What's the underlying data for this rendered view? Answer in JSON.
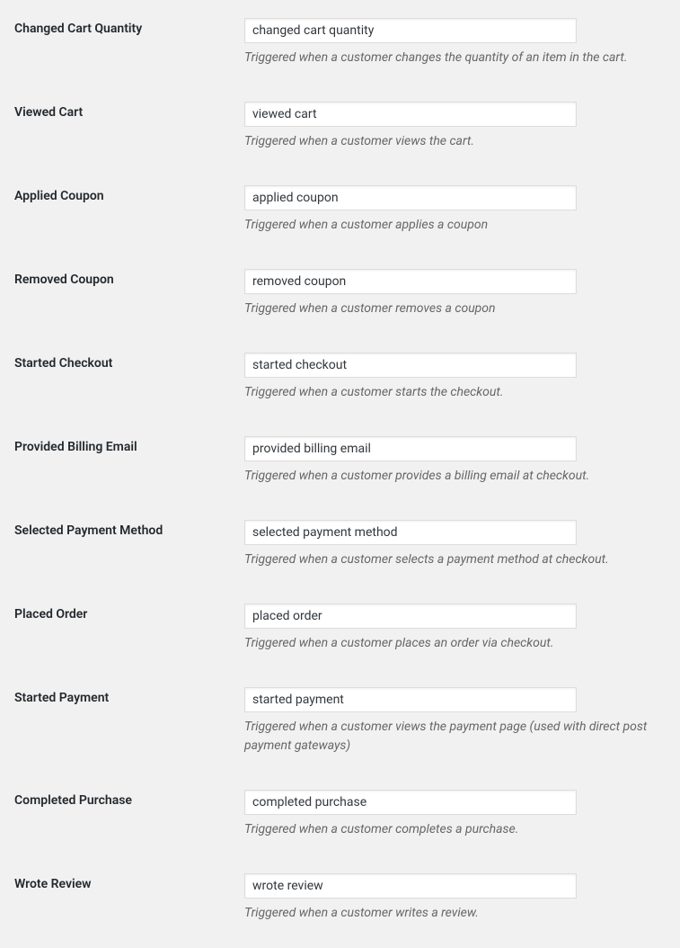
{
  "fields": [
    {
      "label": "Changed Cart Quantity",
      "value": "changed cart quantity",
      "description": "Triggered when a customer changes the quantity of an item in the cart.",
      "name": "changed-cart-quantity"
    },
    {
      "label": "Viewed Cart",
      "value": "viewed cart",
      "description": "Triggered when a customer views the cart.",
      "name": "viewed-cart"
    },
    {
      "label": "Applied Coupon",
      "value": "applied coupon",
      "description": "Triggered when a customer applies a coupon",
      "name": "applied-coupon"
    },
    {
      "label": "Removed Coupon",
      "value": "removed coupon",
      "description": "Triggered when a customer removes a coupon",
      "name": "removed-coupon"
    },
    {
      "label": "Started Checkout",
      "value": "started checkout",
      "description": "Triggered when a customer starts the checkout.",
      "name": "started-checkout"
    },
    {
      "label": "Provided Billing Email",
      "value": "provided billing email",
      "description": "Triggered when a customer provides a billing email at checkout.",
      "name": "provided-billing-email"
    },
    {
      "label": "Selected Payment Method",
      "value": "selected payment method",
      "description": "Triggered when a customer selects a payment method at checkout.",
      "name": "selected-payment-method"
    },
    {
      "label": "Placed Order",
      "value": "placed order",
      "description": "Triggered when a customer places an order via checkout.",
      "name": "placed-order"
    },
    {
      "label": "Started Payment",
      "value": "started payment",
      "description": "Triggered when a customer views the payment page (used with direct post payment gateways)",
      "name": "started-payment"
    },
    {
      "label": "Completed Purchase",
      "value": "completed purchase",
      "description": "Triggered when a customer completes a purchase.",
      "name": "completed-purchase"
    },
    {
      "label": "Wrote Review",
      "value": "wrote review",
      "description": "Triggered when a customer writes a review.",
      "name": "wrote-review"
    }
  ]
}
